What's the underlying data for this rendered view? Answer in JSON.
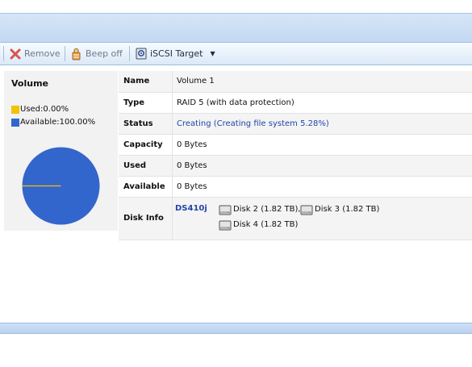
{
  "toolbar": {
    "remove_label": "Remove",
    "beep_off_label": "Beep off",
    "iscsi_label": "iSCSI Target"
  },
  "volume_panel": {
    "title": "Volume",
    "legend": [
      {
        "label": "Used:0.00%",
        "color": "#f2c200"
      },
      {
        "label": "Available:100.00%",
        "color": "#3366cc"
      }
    ]
  },
  "chart_data": {
    "type": "pie",
    "slices": [
      {
        "label": "Used",
        "value": 0.0,
        "color": "#f2c200"
      },
      {
        "label": "Available",
        "value": 100.0,
        "color": "#3366cc"
      }
    ]
  },
  "details": {
    "name_key": "Name",
    "name_value": "Volume 1",
    "type_key": "Type",
    "type_value": "RAID 5 (with data protection)",
    "status_key": "Status",
    "status_value": "Creating (Creating file system 5.28%)",
    "capacity_key": "Capacity",
    "capacity_value": "0 Bytes",
    "used_key": "Used",
    "used_value": "0 Bytes",
    "available_key": "Available",
    "available_value": "0 Bytes",
    "disk_info_key": "Disk Info",
    "device_name": "DS410j",
    "disks": [
      "Disk 2 (1.82 TB),",
      "Disk 3 (1.82 TB)",
      "Disk 4 (1.82 TB)"
    ]
  },
  "colors": {
    "accent": "#3366cc",
    "link": "#1f45a8",
    "used": "#f2c200"
  }
}
